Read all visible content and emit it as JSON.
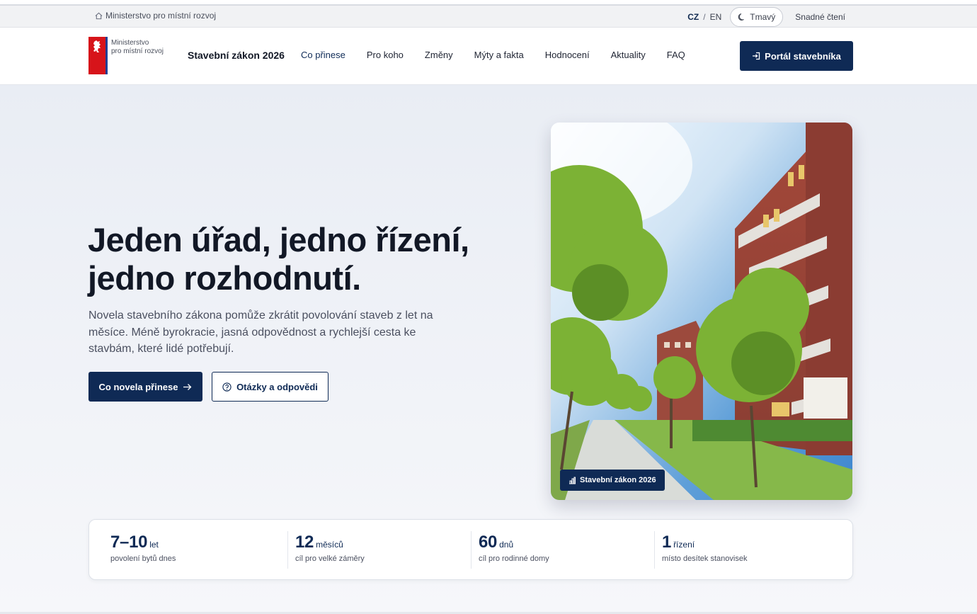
{
  "utility": {
    "ministry_link": "Ministerstvo pro místní rozvoj",
    "lang_cz": "CZ",
    "lang_sep": "/",
    "lang_en": "EN",
    "dark_mode": "Tmavý",
    "easy_reading": "Snadné čtení"
  },
  "header": {
    "logo_line1": "Ministerstvo",
    "logo_line2": "pro místní rozvoj",
    "site_title": "Stavební zákon 2026",
    "nav": [
      "Co přinese",
      "Pro koho",
      "Změny",
      "Mýty a fakta",
      "Hodnocení",
      "Aktuality",
      "FAQ"
    ],
    "portal_button": "Portál stavebníka"
  },
  "hero": {
    "title_line1": "Jeden úřad, jedno řízení,",
    "title_line2": "jedno rozhodnutí.",
    "lead": "Novela stavebního zákona pomůže zkrátit povolování staveb z let na měsíce. Méně byrokracie, jasná odpovědnost a rychlejší cesta ke stavbám, které lidé potřebují.",
    "primary_button": "Co novela přinese",
    "secondary_button": "Otázky a odpovědi",
    "photo_badge": "Stavební zákon 2026"
  },
  "stats": [
    {
      "value": "7–10",
      "unit": "let",
      "desc": "povolení bytů dnes"
    },
    {
      "value": "12",
      "unit": "měsíců",
      "desc": "cíl pro velké záměry"
    },
    {
      "value": "60",
      "unit": "dnů",
      "desc": "cíl pro rodinné domy"
    },
    {
      "value": "1",
      "unit": "řízení",
      "desc": "místo desítek stanovisek"
    }
  ],
  "colors": {
    "primary": "#0f2a55",
    "flag_red": "#d7141a",
    "flag_blue": "#1c3f94"
  }
}
